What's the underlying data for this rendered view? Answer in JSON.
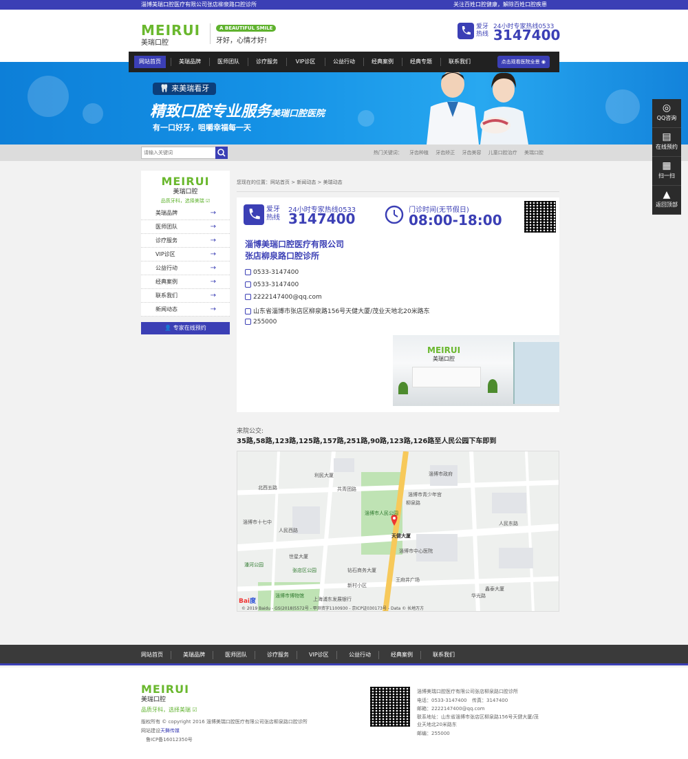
{
  "topbar": {
    "left_text": "淄博美瑞口腔医疗有限公司张店柳泉路口腔诊所",
    "right_text": "关注百姓口腔健康，解除百姓口腔疾患"
  },
  "header": {
    "logo_word": "MEIRUI",
    "logo_cn": "美瑞口腔",
    "badge": "A BEAUTIFUL SMILE",
    "slogan": "牙好，心情才好!",
    "hotline_tag": "爱牙热线",
    "hotline_title": "24小时专家热线0533",
    "hotline_number": "3147400"
  },
  "nav": {
    "items": [
      "网站首页",
      "美瑞品牌",
      "医师团队",
      "诊疗服务",
      "VIP诊区",
      "公益行动",
      "经典案例",
      "经典专题",
      "联系我们"
    ],
    "cta": "点击观看医院全景"
  },
  "banner": {
    "tag": "来美瑞看牙",
    "title": "精致口腔专业服务",
    "title_small": "美瑞口腔医院",
    "subtitle": "有一口好牙，咀嚼幸福每一天"
  },
  "search": {
    "placeholder": "请输入关键词",
    "hot_label": "热门关键词：",
    "hot_words": [
      "牙齿种植",
      "牙齿矫正",
      "牙齿美容",
      "儿童口腔治疗",
      "美瑞口腔"
    ]
  },
  "sidebar": {
    "logo_word": "MEIRUI",
    "logo_cn": "美瑞口腔",
    "tagline": "品质牙科，选择美瑞",
    "items": [
      "美瑞品牌",
      "医师团队",
      "诊疗服务",
      "VIP诊区",
      "公益行动",
      "经典案例",
      "联系我们",
      "新闻动态"
    ],
    "cta": "专家在线预约"
  },
  "breadcrumb": "您现在的位置：网站首页 > 新闻动态 > 美瑞动态",
  "contact": {
    "tag": "爱牙热线",
    "hotline_title": "24小时专家热线0533",
    "hotline_number": "3147400",
    "hours_title": "门诊时间(无节假日)",
    "hours": "08:00-18:00",
    "company_1": "淄博美瑞口腔医疗有限公司",
    "company_2": "张店柳泉路口腔诊所",
    "phone": "0533-3147400",
    "fax": "0533-3147400",
    "email": "2222147400@qq.com",
    "address": "山东省淄博市张店区柳泉路156号天健大厦/茂业天地北20米路东",
    "postcode": "255000",
    "photo_logo": "MEIRUI",
    "photo_logo_cn": "美瑞口腔"
  },
  "bus": {
    "label": "来院公交:",
    "routes": "35路,58路,123路,125路,157路,251路,90路,123路,126路至人民公园下车即到"
  },
  "map": {
    "places": [
      "淄博市政府",
      "淄博市青少年宫",
      "淄博市人民公园",
      "天健大厦",
      "淄博市中心医院",
      "鑫泰大厦",
      "王府井广场",
      "钻石商务大厦",
      "淄博市博物馆",
      "上海浦东发展银行",
      "新村小区",
      "世星大厦",
      "华光路",
      "人民西路",
      "人民东路",
      "柳泉路",
      "共青团路",
      "张店区公园",
      "利民大厦",
      "北西五路",
      "淄博市十七中",
      "潘河公园"
    ],
    "copyright": "© 2019 Baidu - GS(2018)5572号 - 甲测资字1100930 - 京ICP证030173号 - Data © 长地万方"
  },
  "floatbar": [
    "QQ咨询",
    "在线预约",
    "扫一扫",
    "返回顶部"
  ],
  "footnav": [
    "网站首页",
    "美瑞品牌",
    "医师团队",
    "诊疗服务",
    "VIP诊区",
    "公益行动",
    "经典案例",
    "联系我们"
  ],
  "footer": {
    "logo_word": "MEIRUI",
    "logo_cn": "美瑞口腔",
    "tagline": "品质牙科，选择美瑞",
    "copyright": "版权所有 © copyright 2016 淄博美瑞口腔医疗有限公司张店柳泉路口腔诊所",
    "builder_prefix": "网站建设",
    "builder": "天舞传媒",
    "icp": "鲁ICP备16012350号",
    "company": "淄博美瑞口腔医疗有限公司张店柳泉路口腔诊所",
    "tel": "电话：0533-3147400",
    "fax": "传真：3147400",
    "email": "邮箱：2222147400@qq.com",
    "address_1": "联系地址：山东省淄博市张店区柳泉路156号天健大厦/茂",
    "address_2": "业天地北20米路东",
    "postcode": "邮编：255000"
  },
  "colors": {
    "brand_blue": "#3b3fb5",
    "brand_green": "#5fb22e",
    "nav_dark": "#212121"
  }
}
